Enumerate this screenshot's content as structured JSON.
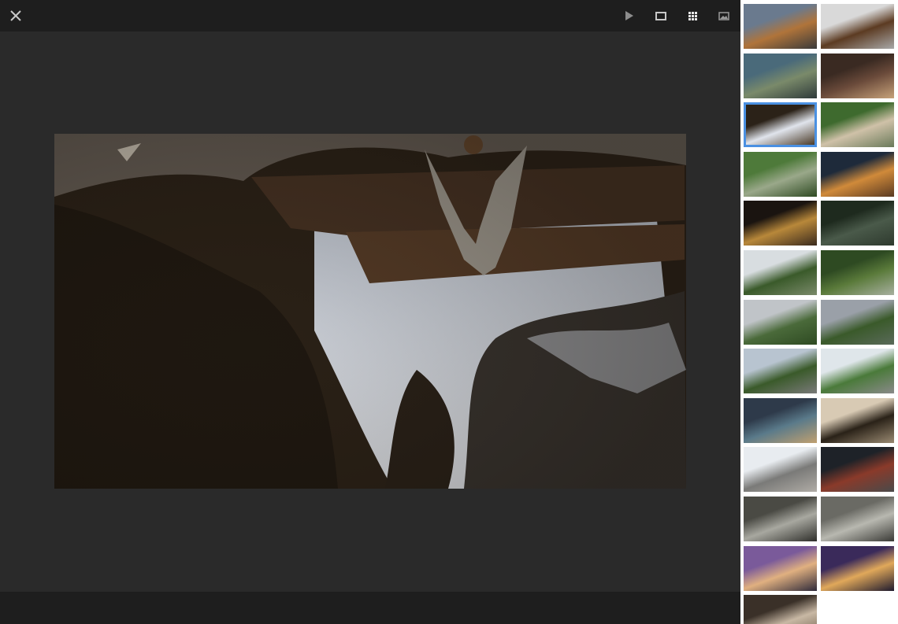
{
  "viewer": {
    "main_photo_icon": "reflection-photo",
    "toolbar": {
      "close_icon": "close-icon",
      "slideshow_icon": "play-icon",
      "fullscreen_icon": "rectangle-icon",
      "grid_icon": "grid-icon",
      "image_icon": "image-icon"
    }
  },
  "thumbnails": [
    {
      "theme": "street-traffic",
      "colors": [
        "#6a7a8e",
        "#b0743a",
        "#3a3a3a"
      ]
    },
    {
      "theme": "temple-roof",
      "colors": [
        "#d9d9d9",
        "#5c3b22",
        "#a8a8a8"
      ]
    },
    {
      "theme": "alley",
      "colors": [
        "#4a6a7a",
        "#7a8a6a",
        "#2e3a3a"
      ]
    },
    {
      "theme": "market-vendor",
      "colors": [
        "#3a2a22",
        "#6a4a3a",
        "#c7a27a"
      ]
    },
    {
      "theme": "reflection",
      "colors": [
        "#2b2218",
        "#e0e4ec",
        "#4a3a28"
      ],
      "selected": true
    },
    {
      "theme": "man-with-hat",
      "colors": [
        "#3e6a2e",
        "#cfc1a8",
        "#6a7a5a"
      ]
    },
    {
      "theme": "river-valley",
      "colors": [
        "#4e7a3a",
        "#9aa88a",
        "#2e4a22"
      ]
    },
    {
      "theme": "food-stall",
      "colors": [
        "#1e2a3a",
        "#d08a3a",
        "#5a3a22"
      ]
    },
    {
      "theme": "night-market",
      "colors": [
        "#1a1410",
        "#b8883a",
        "#3a2a1e"
      ]
    },
    {
      "theme": "forest-stream",
      "colors": [
        "#1e2a1e",
        "#4a5a4a",
        "#2e3a2e"
      ]
    },
    {
      "theme": "jungle-trees",
      "colors": [
        "#d8dde0",
        "#3a5a2a",
        "#7a8a6a"
      ]
    },
    {
      "theme": "tall-tree",
      "colors": [
        "#2e4a22",
        "#5a7a3a",
        "#a8b0a0"
      ]
    },
    {
      "theme": "mountain-cloud",
      "colors": [
        "#c0c4c8",
        "#4a6a3a",
        "#2e4a22"
      ]
    },
    {
      "theme": "mountain-range",
      "colors": [
        "#9aa0a8",
        "#3a5a2a",
        "#5a6a5a"
      ]
    },
    {
      "theme": "road-mountain",
      "colors": [
        "#b8c4d0",
        "#3a5a2a",
        "#7a7a7a"
      ]
    },
    {
      "theme": "rural-road",
      "colors": [
        "#dfe6ea",
        "#4a7a3a",
        "#8a8a8a"
      ]
    },
    {
      "theme": "shop-interior",
      "colors": [
        "#2e3a4a",
        "#5a7a8a",
        "#c0a070"
      ]
    },
    {
      "theme": "sand-branch",
      "colors": [
        "#d8cab4",
        "#2a2218",
        "#9a8a72"
      ]
    },
    {
      "theme": "temple-spires",
      "colors": [
        "#e8ecf0",
        "#7a7a78",
        "#b0aca6"
      ]
    },
    {
      "theme": "workshop",
      "colors": [
        "#1e2228",
        "#8a3a2a",
        "#4a4a4a"
      ]
    },
    {
      "theme": "market-canopy",
      "colors": [
        "#4a4a44",
        "#a8a8a0",
        "#2e2e2a"
      ]
    },
    {
      "theme": "market-street",
      "colors": [
        "#6a6a64",
        "#b8b8b0",
        "#3a3a36"
      ]
    },
    {
      "theme": "temple-dusk",
      "colors": [
        "#7a5a9a",
        "#e0b080",
        "#2e2a3a"
      ]
    },
    {
      "theme": "temple-night",
      "colors": [
        "#3a2a5a",
        "#e0a85a",
        "#1e1a2e"
      ]
    },
    {
      "theme": "partial-photo",
      "colors": [
        "#3a3028",
        "#c8b8a4",
        "#6a5a48"
      ]
    }
  ]
}
